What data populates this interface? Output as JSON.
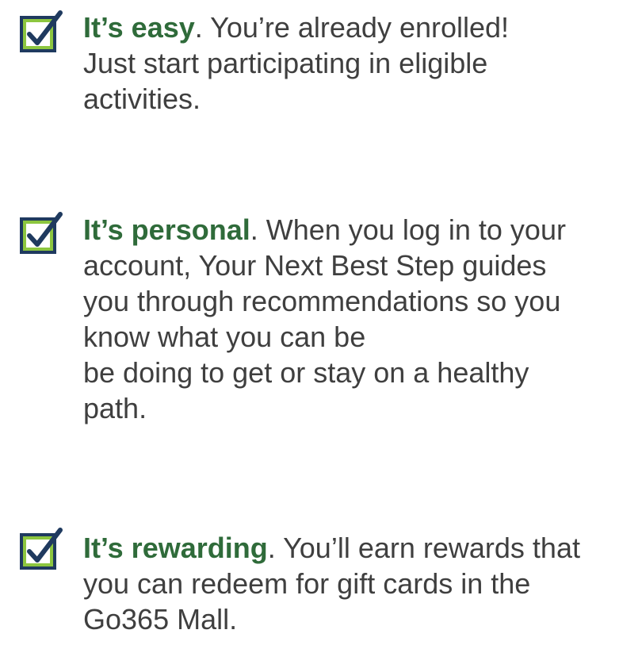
{
  "items": [
    {
      "lead": "It’s easy",
      "first_rest": ". You’re already enrolled!",
      "lines": [
        "Just start participating in eligible",
        "activities."
      ]
    },
    {
      "lead": "It’s personal",
      "first_rest": ". When you log in to your",
      "lines": [
        "account, Your Next Best Step guides",
        "you through recommendations so you",
        "know what you can be",
        "be doing to get or stay on a healthy",
        "path."
      ]
    },
    {
      "lead": "It’s rewarding",
      "first_rest": ". You’ll earn rewards that",
      "lines": [
        "you can redeem for gift cards in the",
        "Go365 Mall."
      ]
    }
  ],
  "colors": {
    "lead_text": "#2f6b3a",
    "body_text": "#3f3f3f",
    "checkbox_fill": "#8cc63f",
    "checkbox_border": "#1f3a5f",
    "checkmark": "#1f3a5f"
  }
}
